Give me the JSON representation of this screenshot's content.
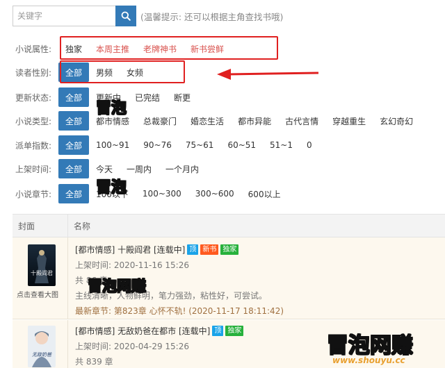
{
  "search": {
    "placeholder": "关键字",
    "hint": "(温馨提示: 还可以根据主角查找书哦)"
  },
  "filters": [
    {
      "label": "小说属性:",
      "options": [
        {
          "text": "独家",
          "active": false,
          "red": false
        },
        {
          "text": "本周主推",
          "red": true
        },
        {
          "text": "老牌神书",
          "red": true
        },
        {
          "text": "新书尝鲜",
          "red": true
        }
      ]
    },
    {
      "label": "读者性别:",
      "options": [
        {
          "text": "全部",
          "active": true
        },
        {
          "text": "男频"
        },
        {
          "text": "女频"
        }
      ]
    },
    {
      "label": "更新状态:",
      "options": [
        {
          "text": "全部",
          "active": true
        },
        {
          "text": "更新中"
        },
        {
          "text": "已完结"
        },
        {
          "text": "断更"
        }
      ]
    },
    {
      "label": "小说类型:",
      "options": [
        {
          "text": "全部",
          "active": true
        },
        {
          "text": "都市情感"
        },
        {
          "text": "总裁豪门"
        },
        {
          "text": "婚恋生活"
        },
        {
          "text": "都市异能"
        },
        {
          "text": "古代言情"
        },
        {
          "text": "穿越重生"
        },
        {
          "text": "玄幻奇幻"
        }
      ]
    },
    {
      "label": "派单指数:",
      "options": [
        {
          "text": "全部",
          "active": true
        },
        {
          "text": "100~91"
        },
        {
          "text": "90~76"
        },
        {
          "text": "75~61"
        },
        {
          "text": "60~51"
        },
        {
          "text": "51~1"
        },
        {
          "text": "0"
        }
      ]
    },
    {
      "label": "上架时间:",
      "options": [
        {
          "text": "全部",
          "active": true
        },
        {
          "text": "今天"
        },
        {
          "text": "一周内"
        },
        {
          "text": "一个月内"
        }
      ]
    },
    {
      "label": "小说章节:",
      "options": [
        {
          "text": "全部",
          "active": true
        },
        {
          "text": "100以下"
        },
        {
          "text": "100~300"
        },
        {
          "text": "300~600"
        },
        {
          "text": "600以上"
        }
      ]
    }
  ],
  "table": {
    "col_cover": "封面",
    "col_name": "名称"
  },
  "books": [
    {
      "title": "[都市情感] 十殿阎君 [连载中]",
      "tags": [
        {
          "text": "顶",
          "color": "#1aa3e8"
        },
        {
          "text": "新书",
          "color": "#ff5a1f"
        },
        {
          "text": "独家",
          "color": "#27b13c"
        }
      ],
      "date": "上架时间: 2020-11-16 15:26",
      "chapters": "共 86 章",
      "intro": "主线清晰，人物鲜明，笔力强劲，粘性好，可尝试。",
      "latest": "最新章节: 第823章 心怀不轨! (2020-11-17 18:11:42)",
      "cover_link": "点击查看大图",
      "cover_text": "十殿阎君"
    },
    {
      "title": "[都市情感] 无敌奶爸在都市 [连载中]",
      "tags": [
        {
          "text": "顶",
          "color": "#1aa3e8"
        },
        {
          "text": "独家",
          "color": "#27b13c"
        }
      ],
      "date": "上架时间: 2020-04-29 15:26",
      "chapters": "共 839 章",
      "cover_text": "无敌奶爸"
    }
  ],
  "watermarks": {
    "bubble": "冒泡",
    "bubble_earn": "冒泡网赚",
    "site": "www.shouyu.cc"
  },
  "colors": {
    "primary": "#337ab7",
    "highlight_box": "#e02020",
    "watermark": "#f7e21a"
  }
}
